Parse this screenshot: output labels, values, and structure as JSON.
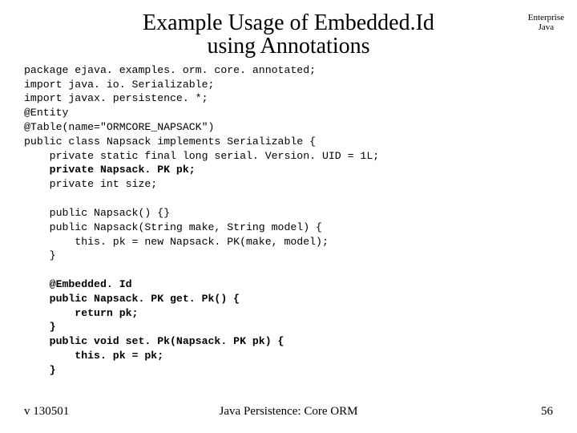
{
  "header": {
    "title_line1": "Example Usage of Embedded.Id",
    "title_line2": "using Annotations",
    "corner_line1": "Enterprise",
    "corner_line2": "Java"
  },
  "code": {
    "l01": "package ejava. examples. orm. core. annotated;",
    "l02": "import java. io. Serializable;",
    "l03": "import javax. persistence. *;",
    "l04": "@Entity",
    "l05": "@Table(name=\"ORMCORE_NAPSACK\")",
    "l06": "public class Napsack implements Serializable {",
    "l07": "    private static final long serial. Version. UID = 1L;",
    "l08": "    private Napsack. PK pk;",
    "l09": "    private int size;",
    "l10": "",
    "l11": "    public Napsack() {}",
    "l12": "    public Napsack(String make, String model) {",
    "l13": "        this. pk = new Napsack. PK(make, model);",
    "l14": "    }",
    "l15": "",
    "l16": "    @Embedded. Id",
    "l17": "    public Napsack. PK get. Pk() {",
    "l18": "        return pk;",
    "l19": "    }",
    "l20": "    public void set. Pk(Napsack. PK pk) {",
    "l21": "        this. pk = pk;",
    "l22": "    }"
  },
  "footer": {
    "left": "v 130501",
    "center": "Java Persistence: Core ORM",
    "right": "56"
  }
}
